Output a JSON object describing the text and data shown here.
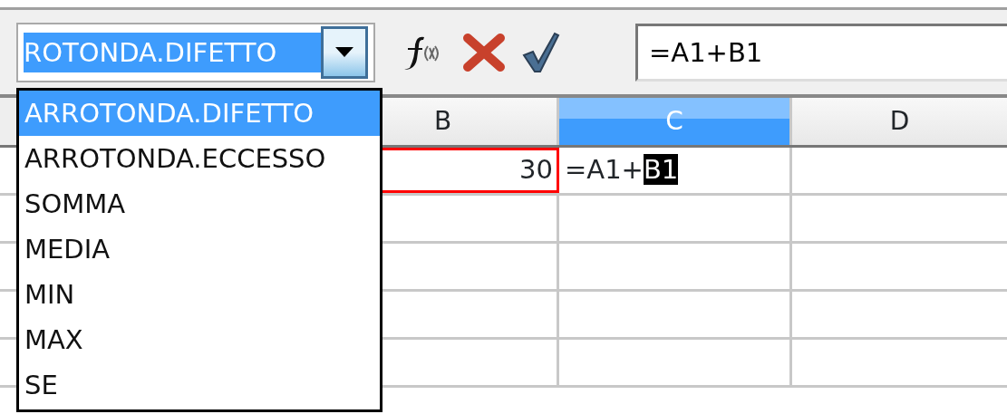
{
  "name_box": {
    "value": "ROTONDA.DIFETTO",
    "text_selected": true
  },
  "function_list": [
    {
      "label": "ARROTONDA.DIFETTO",
      "selected": true
    },
    {
      "label": "ARROTONDA.ECCESSO",
      "selected": false
    },
    {
      "label": "SOMMA",
      "selected": false
    },
    {
      "label": "MEDIA",
      "selected": false
    },
    {
      "label": "MIN",
      "selected": false
    },
    {
      "label": "MAX",
      "selected": false
    },
    {
      "label": "SE",
      "selected": false
    }
  ],
  "formula_input": {
    "value": "=A1+B1"
  },
  "columns": [
    {
      "label": "B",
      "selected": false
    },
    {
      "label": "C",
      "selected": true
    },
    {
      "label": "D",
      "selected": false
    }
  ],
  "cell_b1": {
    "value": "30",
    "referenced": true
  },
  "cell_c1": {
    "text": "=A1+",
    "selected_text": "B1"
  }
}
